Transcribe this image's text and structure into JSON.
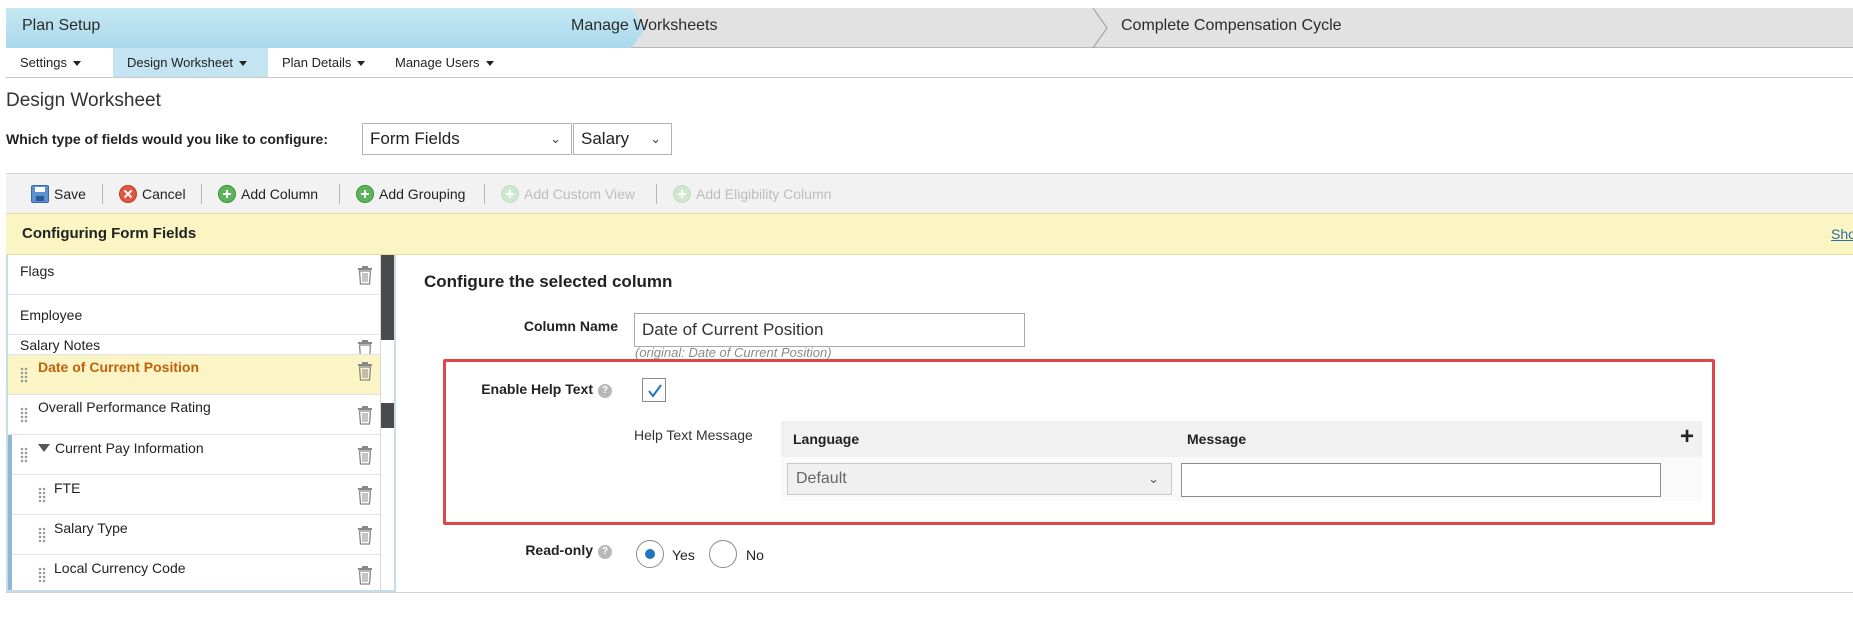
{
  "steps": [
    {
      "label": "Plan Setup",
      "active": true
    },
    {
      "label": "Manage Worksheets",
      "active": false
    },
    {
      "label": "Complete Compensation Cycle",
      "active": false
    }
  ],
  "subnav": [
    {
      "label": "Settings",
      "active": false
    },
    {
      "label": "Design Worksheet",
      "active": true
    },
    {
      "label": "Plan Details",
      "active": false
    },
    {
      "label": "Manage Users",
      "active": false
    }
  ],
  "page_title": "Design Worksheet",
  "field_type": {
    "question": "Which type of fields would you like to configure:",
    "type_value": "Form Fields",
    "sub_value": "Salary"
  },
  "toolbar": {
    "save": "Save",
    "cancel": "Cancel",
    "add_column": "Add Column",
    "add_grouping": "Add Grouping",
    "add_custom_view": "Add Custom View",
    "add_eligibility_column": "Add Eligibility Column"
  },
  "banner": {
    "title": "Configuring Form Fields",
    "link": "Sho"
  },
  "column_list": [
    {
      "label": "Flags"
    },
    {
      "label": "Employee"
    },
    {
      "label": "Salary Notes"
    },
    {
      "label": "Date of Current Position",
      "selected": true
    },
    {
      "label": "Overall Performance Rating"
    },
    {
      "label": "Current Pay Information",
      "group": true
    },
    {
      "label": "FTE"
    },
    {
      "label": "Salary Type"
    },
    {
      "label": "Local Currency Code"
    }
  ],
  "config": {
    "title": "Configure the selected column",
    "column_name_label": "Column Name",
    "column_name_value": "Date of Current Position",
    "original_text": "(original: Date of Current Position)",
    "enable_help_label": "Enable Help Text",
    "enable_help_checked": true,
    "help_message_label": "Help Text Message",
    "language_header": "Language",
    "message_header": "Message",
    "add_symbol": "+",
    "language_value": "Default",
    "message_value": "",
    "readonly_label": "Read-only",
    "readonly_yes": "Yes",
    "readonly_no": "No",
    "readonly_value": "Yes"
  },
  "icons": {
    "save": "save-icon",
    "cancel": "cancel-icon",
    "add": "add-icon",
    "trash": "trash-icon",
    "help": "help-icon",
    "drag": "drag-handle-icon"
  },
  "colors": {
    "step_active": "#b8e0ef",
    "subnav_active": "#c4e4f1",
    "banner": "#fbf4c3",
    "selected_row": "#fbf5c6",
    "selected_text": "#c3610a",
    "highlight_border": "#e04848",
    "radio_checked": "#1f74c4"
  }
}
